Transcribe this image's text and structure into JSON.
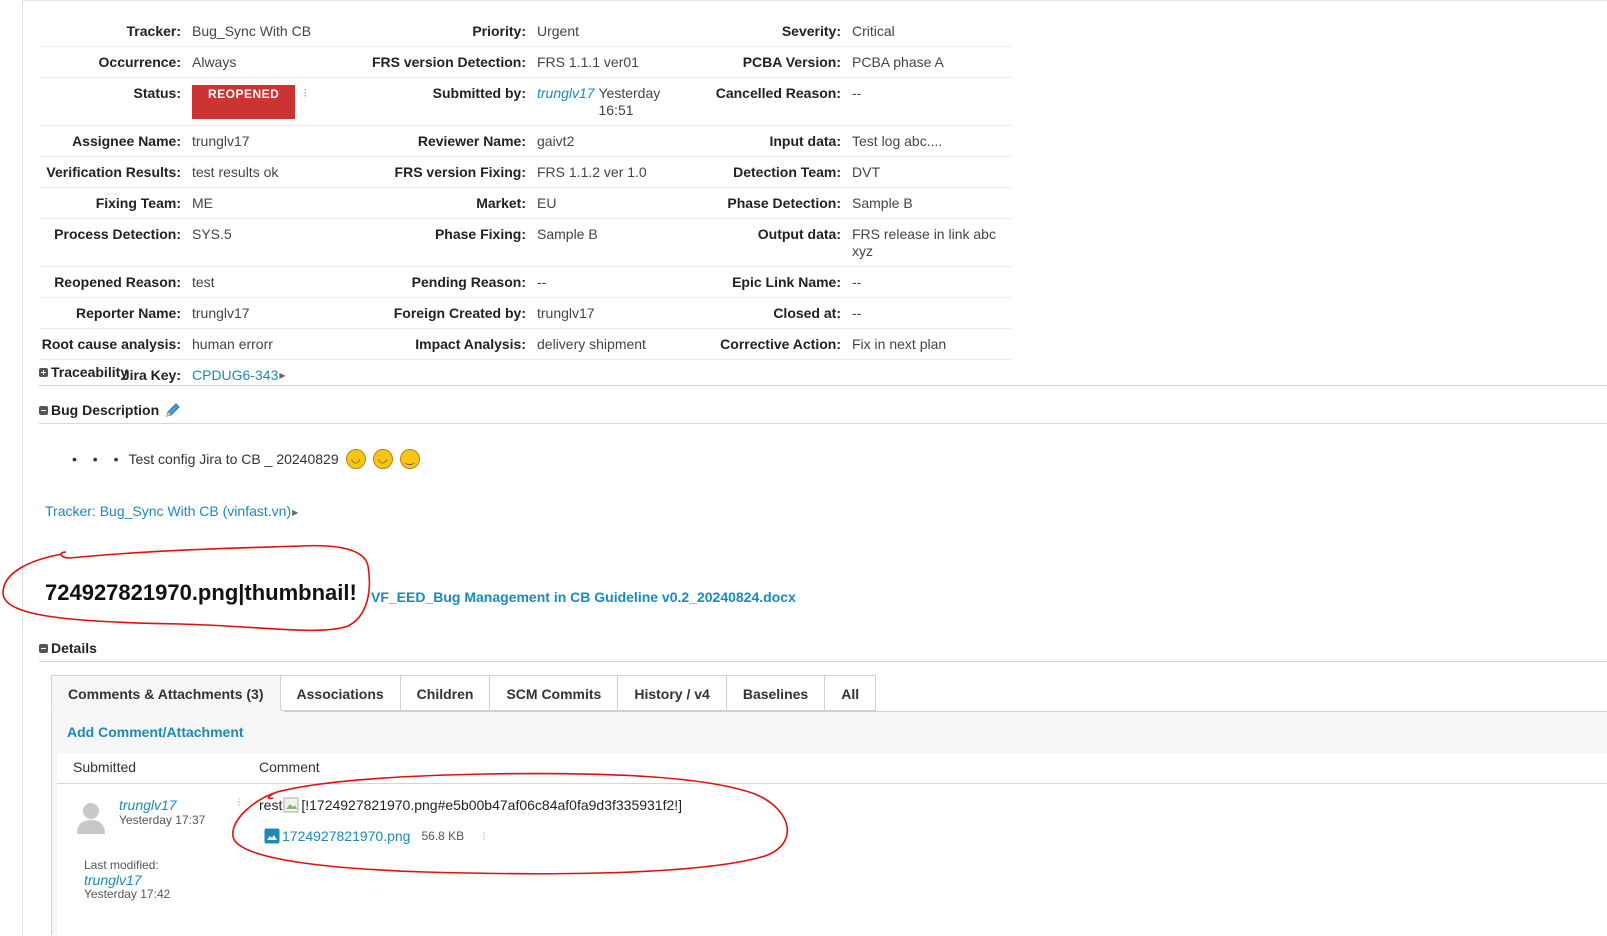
{
  "properties": [
    [
      {
        "label": "Tracker:",
        "value": "Bug_Sync With CB"
      },
      {
        "label": "Priority:",
        "value": "Urgent"
      },
      {
        "label": "Severity:",
        "value": "Critical"
      }
    ],
    [
      {
        "label": "Occurrence:",
        "value": "Always"
      },
      {
        "label": "FRS version Detection:",
        "value": "FRS 1.1.1 ver01"
      },
      {
        "label": "PCBA Version:",
        "value": "PCBA phase A"
      }
    ],
    [
      {
        "label": "Status:",
        "value": "REOPENED"
      },
      {
        "label": "Submitted by:",
        "user": "trunglv17",
        "value": "Yesterday 16:51"
      },
      {
        "label": "Cancelled Reason:",
        "value": "--"
      }
    ],
    [
      {
        "label": "Assignee Name:",
        "value": "trunglv17"
      },
      {
        "label": "Reviewer Name:",
        "value": "gaivt2"
      },
      {
        "label": "Input data:",
        "value": "Test log abc...."
      }
    ],
    [
      {
        "label": "Verification Results:",
        "value": "test results ok"
      },
      {
        "label": "FRS version Fixing:",
        "value": "FRS 1.1.2 ver 1.0"
      },
      {
        "label": "Detection Team:",
        "value": "DVT"
      }
    ],
    [
      {
        "label": "Fixing Team:",
        "value": "ME"
      },
      {
        "label": "Market:",
        "value": "EU"
      },
      {
        "label": "Phase Detection:",
        "value": "Sample B"
      }
    ],
    [
      {
        "label": "Process Detection:",
        "value": "SYS.5"
      },
      {
        "label": "Phase Fixing:",
        "value": "Sample B"
      },
      {
        "label": "Output data:",
        "value": "FRS release in link abc xyz"
      }
    ],
    [
      {
        "label": "Reopened Reason:",
        "value": "test"
      },
      {
        "label": "Pending Reason:",
        "value": "--"
      },
      {
        "label": "Epic Link Name:",
        "value": "--"
      }
    ],
    [
      {
        "label": "Reporter Name:",
        "value": "trunglv17"
      },
      {
        "label": "Foreign Created by:",
        "value": "trunglv17"
      },
      {
        "label": "Closed at:",
        "value": "--"
      }
    ],
    [
      {
        "label": "Root cause analysis:",
        "value": "human errorr"
      },
      {
        "label": "Impact Analysis:",
        "value": "delivery shipment"
      },
      {
        "label": "Corrective Action:",
        "value": "Fix in next plan"
      }
    ]
  ],
  "jira": {
    "label": "Jira Key:",
    "value": "CPDUG6-343"
  },
  "sections": {
    "traceability": "Traceability",
    "bug_description": "Bug Description",
    "details": "Details"
  },
  "description": {
    "bullets": "• • •",
    "text": "Test config Jira to CB _ 20240829"
  },
  "tracker_link": "Tracker: Bug_Sync With CB (vinfast.vn)",
  "big_text": "724927821970.png|thumbnail!",
  "doc_link": "VF_EED_Bug Management in CB Guideline v0.2_20240824.docx",
  "tabs": [
    "Comments & Attachments (3)",
    "Associations",
    "Children",
    "SCM Commits",
    "History / v4",
    "Baselines",
    "All"
  ],
  "add_comment": "Add Comment/Attachment",
  "table_headers": {
    "submitted": "Submitted",
    "comment": "Comment"
  },
  "comment": {
    "user": "trunglv17",
    "time": "Yesterday 17:37",
    "last_modified_label": "Last modified:",
    "modified_user": "trunglv17",
    "modified_time": "Yesterday 17:42",
    "text_prefix": "rest",
    "text_body": "[!1724927821970.png#e5b00b47af06c84af0fa9d3f335931f2!]",
    "attachment_name": "1724927821970.png",
    "attachment_size": "56.8 KB"
  },
  "colors": {
    "link": "#1b8ab8",
    "status": "#cc3333",
    "annotation": "#e01010"
  }
}
